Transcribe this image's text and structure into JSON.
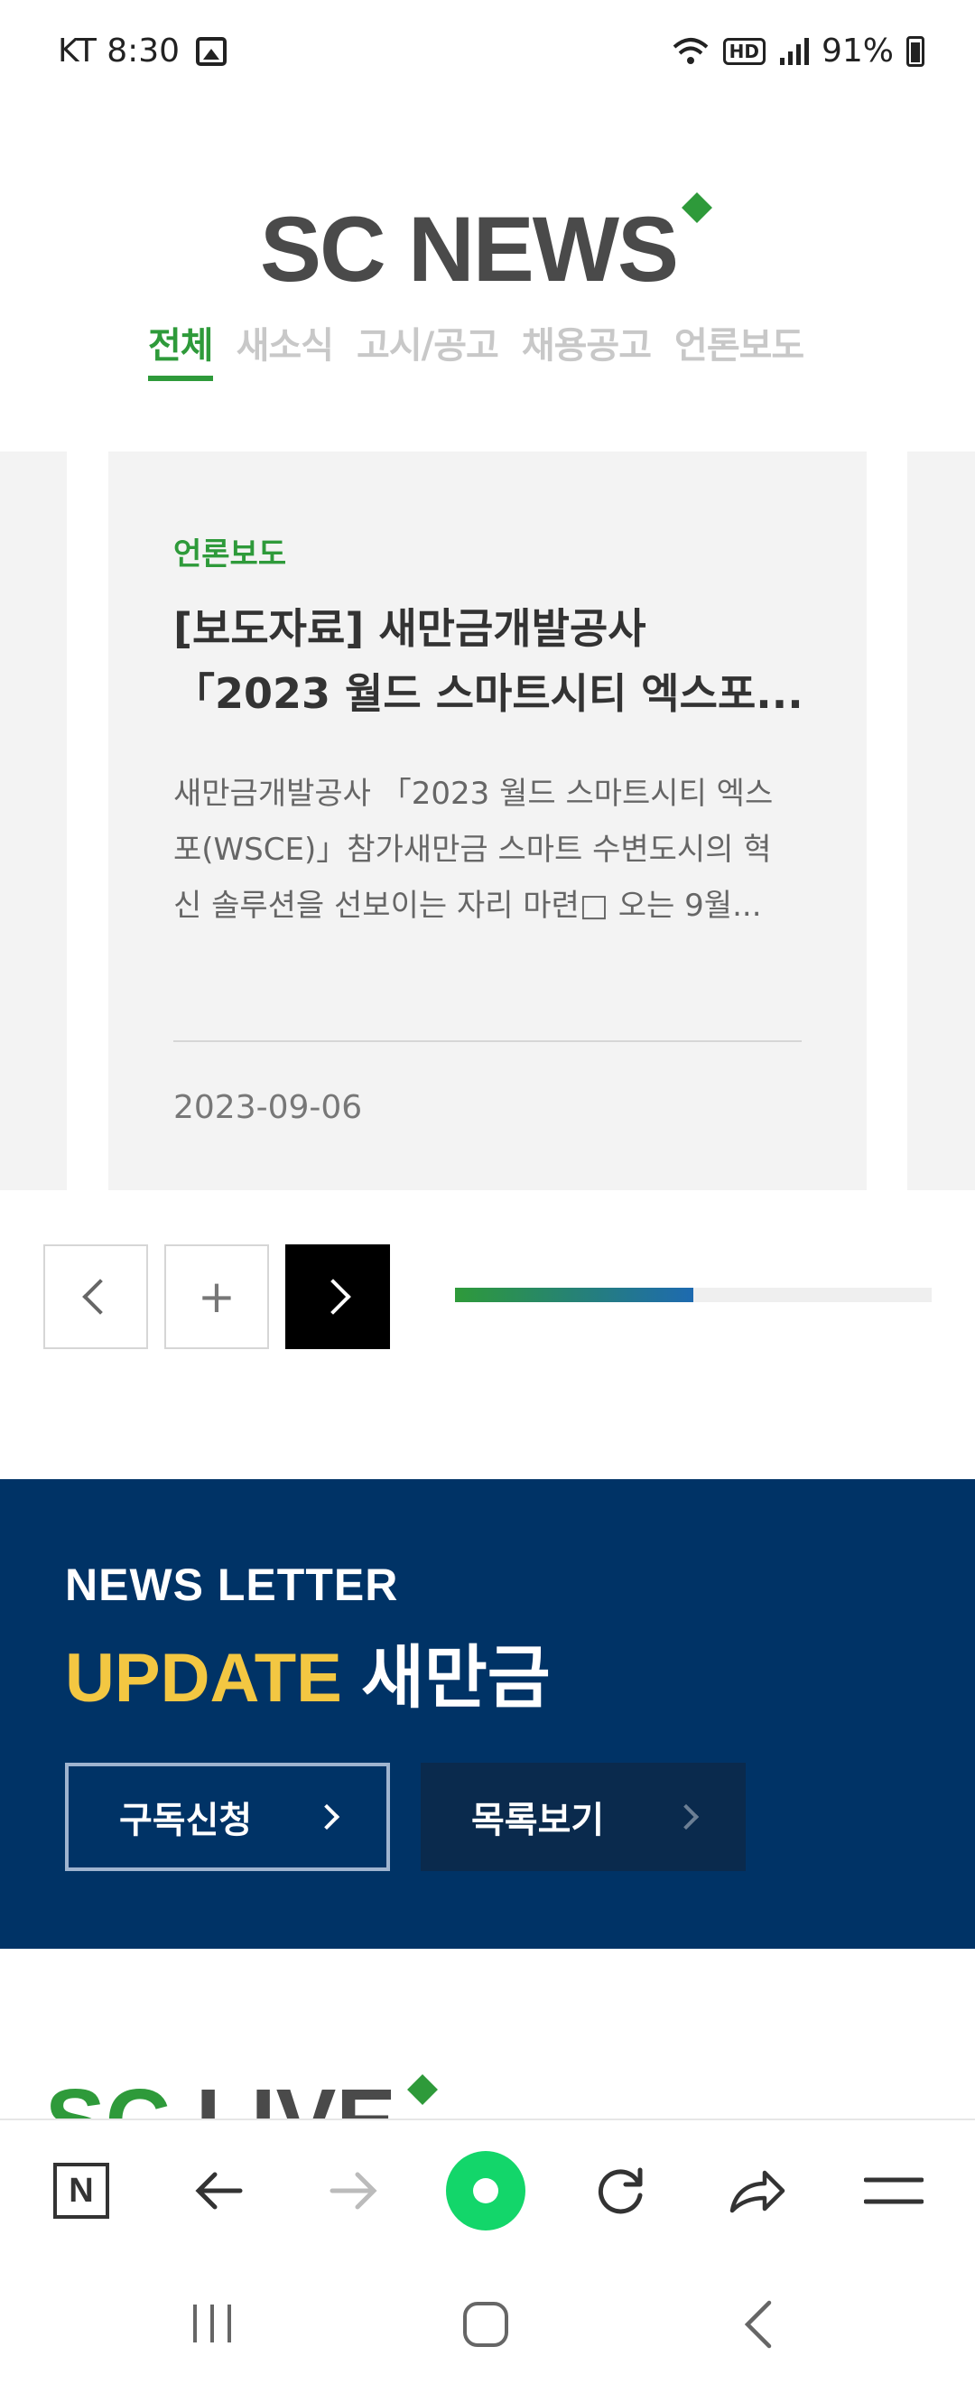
{
  "status_bar": {
    "carrier_time": "KT 8:30",
    "hd_badge": "HD",
    "battery": "91%"
  },
  "header": {
    "brand": "SC NEWS",
    "tabs": [
      {
        "label": "전체",
        "active": true
      },
      {
        "label": "새소식",
        "active": false
      },
      {
        "label": "고시/공고",
        "active": false
      },
      {
        "label": "채용공고",
        "active": false
      },
      {
        "label": "언론보도",
        "active": false
      }
    ]
  },
  "news_card": {
    "category": "언론보도",
    "title": "[보도자료] 새만금개발공사\n「2023 월드 스마트시티 엑스포...",
    "summary": "새만금개발공사 「2023 월드 스마트시티 엑스포(WSCE)」참가새만금 스마트 수변도시의 혁신 솔루션을 선보이는 자리 마련□ 오는 9월...",
    "date": "2023-09-06"
  },
  "carousel_controls": {
    "plus_label": "+",
    "progress_fraction": 0.5
  },
  "newsletter": {
    "kicker": "NEWS LETTER",
    "title_accent": "UPDATE",
    "title_rest": "새만금",
    "subscribe_label": "구독신청",
    "list_label": "목록보기"
  },
  "next_section": {
    "title_part1": "SC",
    "title_part2": "LIVE"
  },
  "browser_toolbar": {
    "logo_label": "N",
    "icons": [
      "naver-icon",
      "back-arrow-icon",
      "forward-arrow-icon",
      "home-icon",
      "refresh-icon",
      "share-icon",
      "menu-icon"
    ]
  },
  "colors": {
    "brand_green": "#2e9a3a",
    "newsletter_navy": "#003366",
    "accent_yellow": "#f3c742",
    "browser_green": "#13d66a"
  }
}
